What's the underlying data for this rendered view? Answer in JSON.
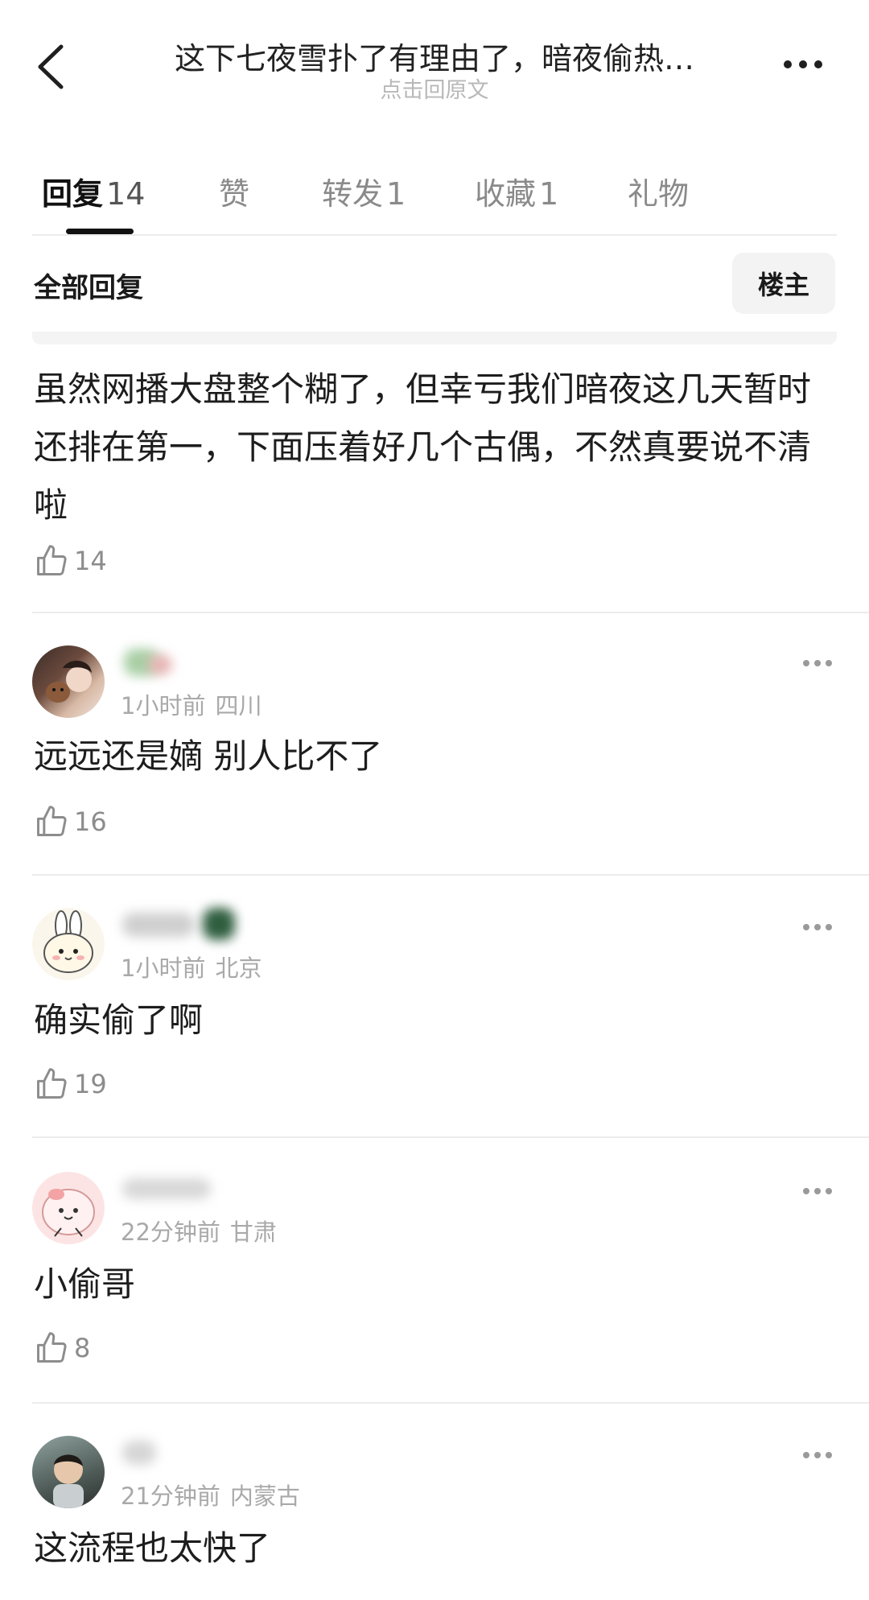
{
  "header": {
    "title": "这下七夜雪扑了有理由了，暗夜偷热…",
    "subtitle": "点击回原文"
  },
  "tabs": [
    {
      "label": "回复",
      "count": "14"
    },
    {
      "label": "赞",
      "count": ""
    },
    {
      "label": "转发",
      "count": "1"
    },
    {
      "label": "收藏",
      "count": "1"
    },
    {
      "label": "礼物",
      "count": ""
    }
  ],
  "filter": {
    "title": "全部回复",
    "op_button": "楼主"
  },
  "main_comment": {
    "text": "虽然网播大盘整个糊了，但幸亏我们暗夜这几天暂时还排在第一，下面压着好几个古偶，不然真要说不清啦",
    "likes": "14"
  },
  "comments": [
    {
      "time": "1小时前",
      "location": "四川",
      "text": "远远还是嫡 别人比不了",
      "likes": "16",
      "avatar_icon": "woman-with-dog-avatar"
    },
    {
      "time": "1小时前",
      "location": "北京",
      "text": "确实偷了啊",
      "likes": "19",
      "avatar_icon": "cartoon-rabbit-avatar"
    },
    {
      "time": "22分钟前",
      "location": "甘肃",
      "text": "小偷哥",
      "likes": "8",
      "avatar_icon": "cartoon-pink-creature-avatar"
    },
    {
      "time": "21分钟前",
      "location": "内蒙古",
      "text": "这流程也太快了",
      "likes": "",
      "avatar_icon": "child-photo-avatar"
    }
  ],
  "colors": {
    "accent": "#111111",
    "muted_text": "#a9a9a9",
    "divider": "#ececec"
  }
}
